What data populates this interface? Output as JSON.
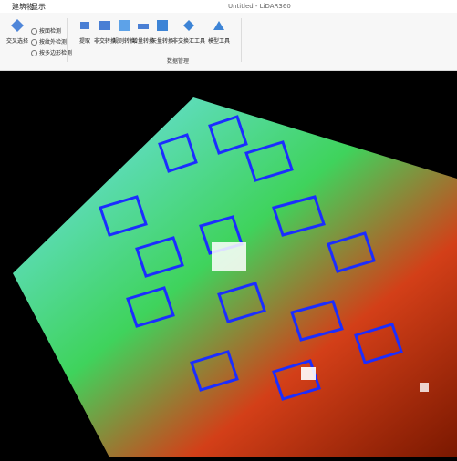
{
  "window": {
    "title": "Untitled - LiDAR360"
  },
  "tabs": [
    "",
    "建筑物",
    "显示"
  ],
  "ribbon": {
    "left_button": "交叉选择",
    "options": [
      "按面检测",
      "按纹外检测",
      "按多边形检测"
    ],
    "buttons": [
      "提取",
      "非交转换",
      "规则转换",
      "增量转换",
      "矢量转换",
      "非交换汇工具",
      "模型工具"
    ],
    "group_label": "数据管理"
  },
  "viewport": {
    "description_colors": {
      "blue": "#1b2dff",
      "red": "#8b1c00",
      "green": "#3fd35c",
      "cyan": "#67e0ff"
    }
  }
}
